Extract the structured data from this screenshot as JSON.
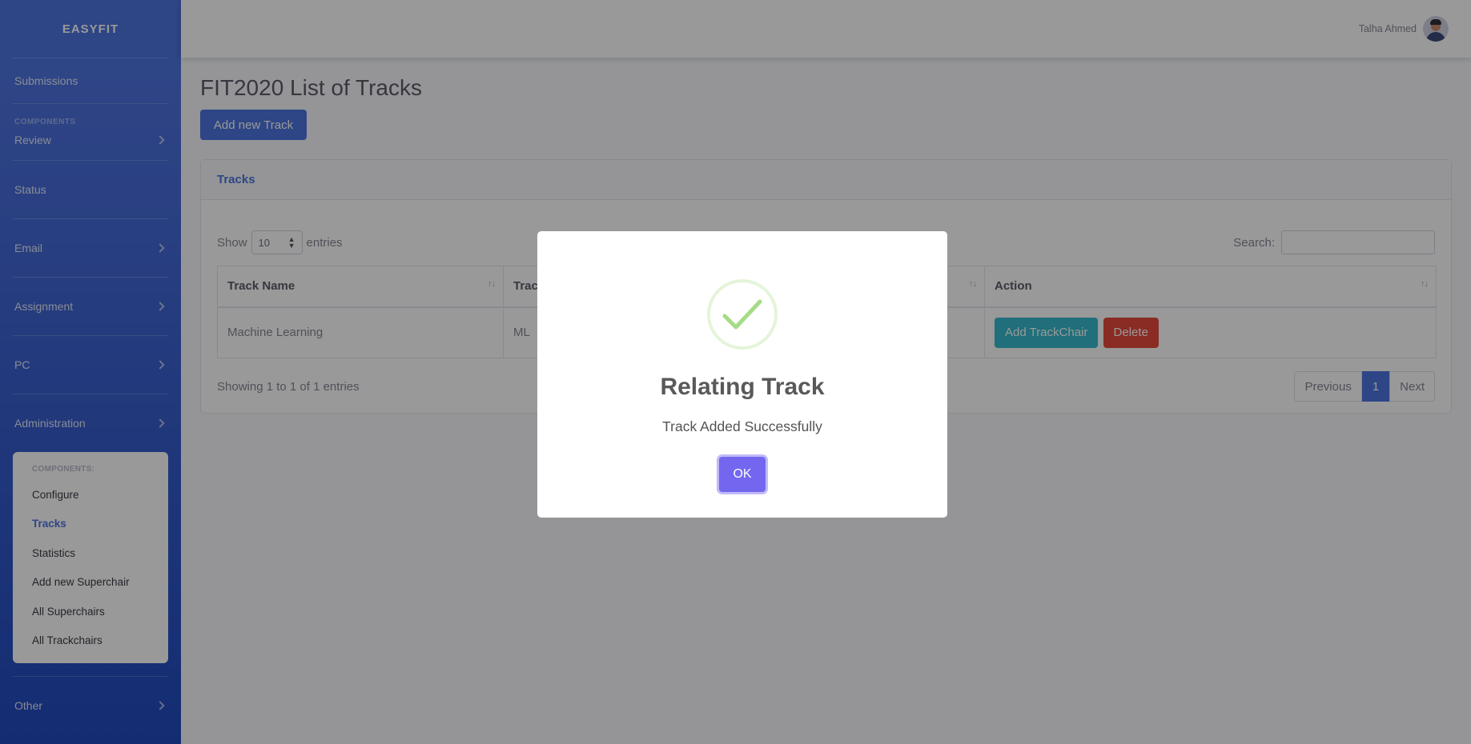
{
  "sidebar": {
    "brand": "EASYFIT",
    "submissions": "Submissions",
    "heading": "COMPONENTS",
    "items": [
      {
        "label": "Review"
      },
      {
        "label": "Status"
      },
      {
        "label": "Email"
      },
      {
        "label": "Assignment"
      },
      {
        "label": "PC"
      },
      {
        "label": "Administration"
      },
      {
        "label": "Other"
      }
    ],
    "submenu": {
      "heading": "COMPONENTS:",
      "items": [
        {
          "label": "Configure"
        },
        {
          "label": "Tracks"
        },
        {
          "label": "Statistics"
        },
        {
          "label": "Add new Superchair"
        },
        {
          "label": "All Superchairs"
        },
        {
          "label": "All Trackchairs"
        }
      ]
    }
  },
  "topbar": {
    "user_name": "Talha Ahmed"
  },
  "page": {
    "title": "FIT2020 List of Tracks",
    "add_button": "Add new Track"
  },
  "card": {
    "header": "Tracks",
    "show_label": "Show",
    "entries_label": "entries",
    "entries_value": "10",
    "search_label": "Search:",
    "columns": [
      "Track Name",
      "Trac",
      "Action"
    ],
    "rows": [
      {
        "name": "Machine Learning",
        "short": "ML",
        "action_primary": "Add TrackChair",
        "action_danger": "Delete"
      }
    ],
    "info": "Showing 1 to 1 of 1 entries",
    "pagination": {
      "previous": "Previous",
      "current": "1",
      "next": "Next"
    }
  },
  "modal": {
    "icon": "success-check-icon",
    "title": "Relating Track",
    "message": "Track Added Successfully",
    "ok_label": "OK",
    "accent_color": "#7367f0"
  }
}
